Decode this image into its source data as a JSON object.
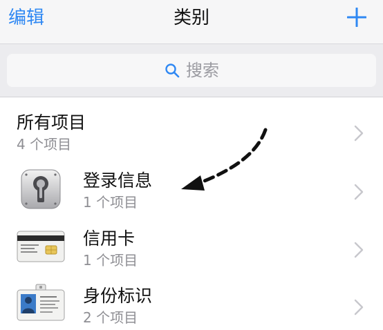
{
  "navbar": {
    "edit_label": "编辑",
    "title": "类别",
    "add_icon": "plus-icon"
  },
  "search": {
    "placeholder": "搜索",
    "icon": "search-icon"
  },
  "list": {
    "all": {
      "title": "所有项目",
      "count": "4 个项目"
    },
    "items": [
      {
        "title": "登录信息",
        "count": "1 个项目",
        "icon": "keyhole-lock-icon"
      },
      {
        "title": "信用卡",
        "count": "1 个项目",
        "icon": "credit-card-icon"
      },
      {
        "title": "身份标识",
        "count": "2 个项目",
        "icon": "id-badge-icon"
      }
    ]
  },
  "colors": {
    "accent": "#2f88f3",
    "nav_bg": "#f6f6f7",
    "search_bg": "#ececef",
    "secondary_text": "#8e8e93",
    "chevron": "#c7c7cc"
  }
}
